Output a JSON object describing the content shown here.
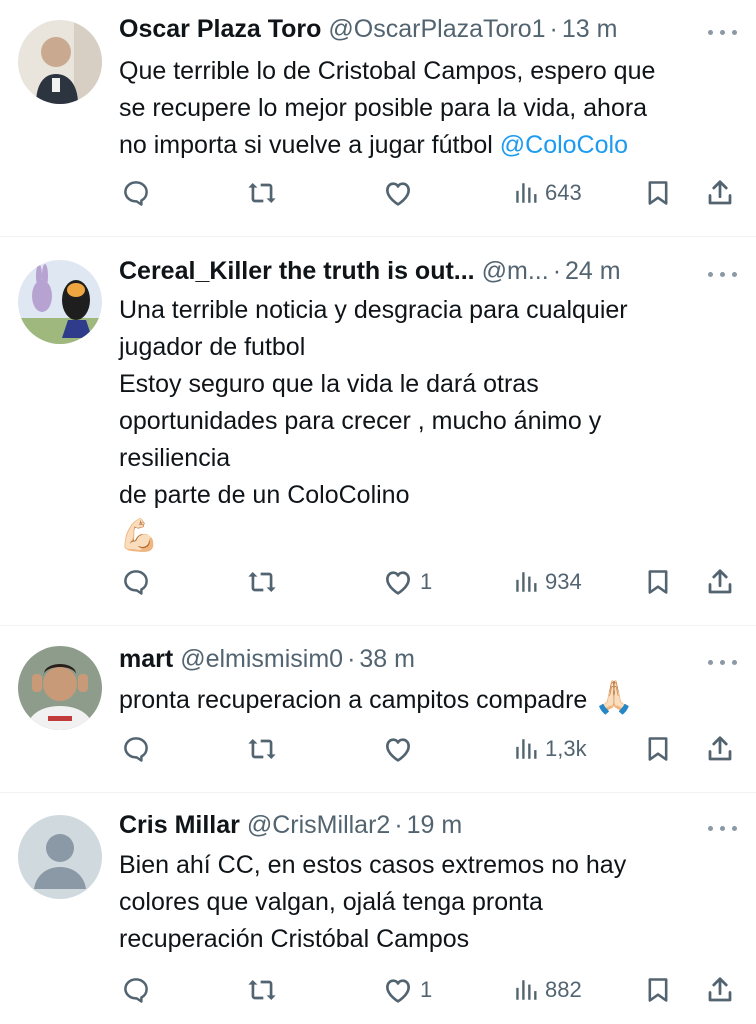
{
  "tweets": [
    {
      "name": "Oscar Plaza Toro",
      "handle": "@OscarPlazaToro1",
      "sep": "·",
      "time": "13 m",
      "text": "Que terrible lo de Cristobal Campos, espero que\nse recupere lo mejor posible para la vida, ahora\nno importa si vuelve a jugar fútbol ",
      "mention": "@ColoColo",
      "likes": "",
      "views": "643"
    },
    {
      "name": "Cereal_Killer the truth is out...",
      "handle": "@m...",
      "sep": "·",
      "time": "24 m",
      "text": "Una terrible noticia y desgracia para cualquier\njugador de futbol\nEstoy seguro que la vida le dará otras\noportunidades para crecer , mucho ánimo y\nresiliencia\nde parte de un ColoColino",
      "emoji": "💪🏻",
      "likes": "1",
      "views": "934"
    },
    {
      "name": "mart",
      "handle": "@elmismisim0",
      "sep": "·",
      "time": "38 m",
      "text": "pronta recuperacion a campitos compadre ",
      "emoji": "🙏🏻",
      "likes": "",
      "views": "1,3k"
    },
    {
      "name": "Cris Millar",
      "handle": "@CrisMillar2",
      "sep": "·",
      "time": "19 m",
      "text": "Bien ahí CC, en estos casos extremos no hay\ncolores que valgan, ojalá tenga pronta\nrecuperación Cristóbal Campos",
      "likes": "1",
      "views": "882"
    }
  ],
  "icons": {
    "reply": "reply-icon",
    "retweet": "retweet-icon",
    "like": "heart-icon",
    "views": "views-icon",
    "bookmark": "bookmark-icon",
    "share": "share-icon",
    "more": "more-icon"
  },
  "colors": {
    "text": "#0f1419",
    "secondary": "#536471",
    "link": "#1d9bf0",
    "separator": "#eff3f4"
  }
}
